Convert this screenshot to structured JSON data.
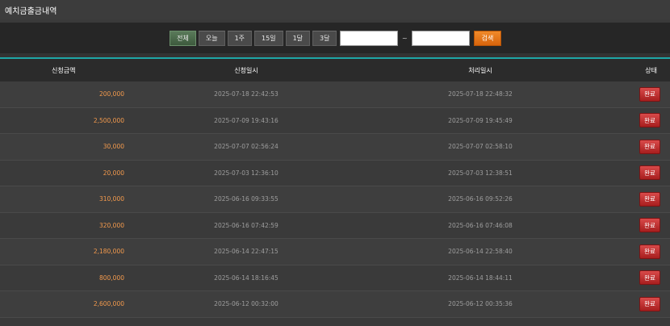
{
  "page": {
    "title": "예치금출금내역"
  },
  "filters": {
    "periods": [
      {
        "label": "전체",
        "active": true
      },
      {
        "label": "오늘",
        "active": false
      },
      {
        "label": "1주",
        "active": false
      },
      {
        "label": "15일",
        "active": false
      },
      {
        "label": "1달",
        "active": false
      },
      {
        "label": "3달",
        "active": false
      }
    ],
    "start_date": "",
    "separator": "~",
    "end_date": "",
    "search_label": "검색"
  },
  "table": {
    "headers": {
      "amount": "신청금액",
      "request_time": "신청일시",
      "process_time": "처리일시",
      "status": "상태"
    },
    "rows": [
      {
        "amount": "200,000",
        "request_time": "2025-07-18 22:42:53",
        "process_time": "2025-07-18 22:48:32",
        "status": "완료"
      },
      {
        "amount": "2,500,000",
        "request_time": "2025-07-09 19:43:16",
        "process_time": "2025-07-09 19:45:49",
        "status": "완료"
      },
      {
        "amount": "30,000",
        "request_time": "2025-07-07 02:56:24",
        "process_time": "2025-07-07 02:58:10",
        "status": "완료"
      },
      {
        "amount": "20,000",
        "request_time": "2025-07-03 12:36:10",
        "process_time": "2025-07-03 12:38:51",
        "status": "완료"
      },
      {
        "amount": "310,000",
        "request_time": "2025-06-16 09:33:55",
        "process_time": "2025-06-16 09:52:26",
        "status": "완료"
      },
      {
        "amount": "320,000",
        "request_time": "2025-06-16 07:42:59",
        "process_time": "2025-06-16 07:46:08",
        "status": "완료"
      },
      {
        "amount": "2,180,000",
        "request_time": "2025-06-14 22:47:15",
        "process_time": "2025-06-14 22:58:40",
        "status": "완료"
      },
      {
        "amount": "800,000",
        "request_time": "2025-06-14 18:16:45",
        "process_time": "2025-06-14 18:44:11",
        "status": "완료"
      },
      {
        "amount": "2,600,000",
        "request_time": "2025-06-12 00:32:00",
        "process_time": "2025-06-12 00:35:36",
        "status": "완료"
      }
    ]
  },
  "colors": {
    "accent_line": "#1ea6a6",
    "amount_text": "#f39a4d",
    "status_button": "#c03030",
    "search_button": "#e8761a"
  }
}
